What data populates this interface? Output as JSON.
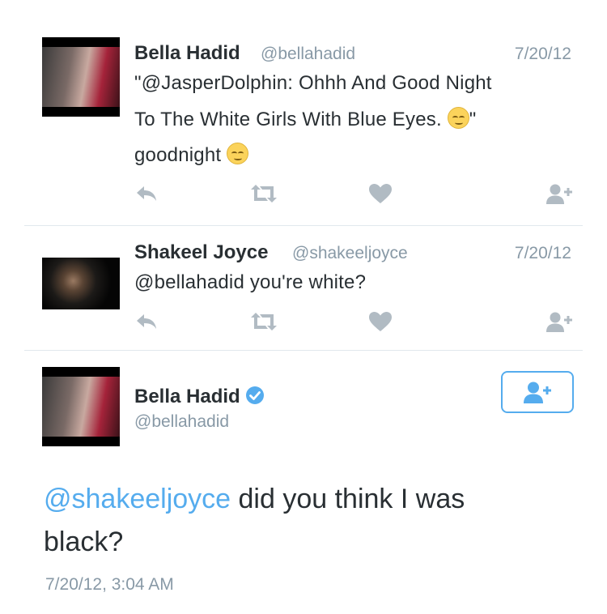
{
  "tweets": [
    {
      "name": "Bella Hadid",
      "handle": "@bellahadid",
      "date": "7/20/12",
      "lines": [
        "\"@JasperDolphin: Ohhh And Good Night",
        "To The White Girls With Blue Eyes.",
        "\"",
        "goodnight"
      ]
    },
    {
      "name": "Shakeel Joyce",
      "handle": "@shakeeljoyce",
      "date": "7/20/12",
      "lines": [
        "@bellahadid you're white?"
      ]
    }
  ],
  "focused_tweet": {
    "name": "Bella Hadid",
    "handle": "@bellahadid",
    "mention": "@shakeeljoyce",
    "text_rest": " did you think I was",
    "text_line2": "black?",
    "timestamp": "7/20/12, 3:04 AM"
  },
  "icons": {
    "reply": "reply-icon",
    "retweet": "retweet-icon",
    "like": "heart-icon",
    "follow": "follow-user-icon",
    "verified": "verified-badge-icon",
    "emoji": "relieved-face-emoji"
  },
  "colors": {
    "text": "#292f33",
    "secondary": "#8899a6",
    "icons": "#b1bbc3",
    "accent": "#55acee"
  }
}
